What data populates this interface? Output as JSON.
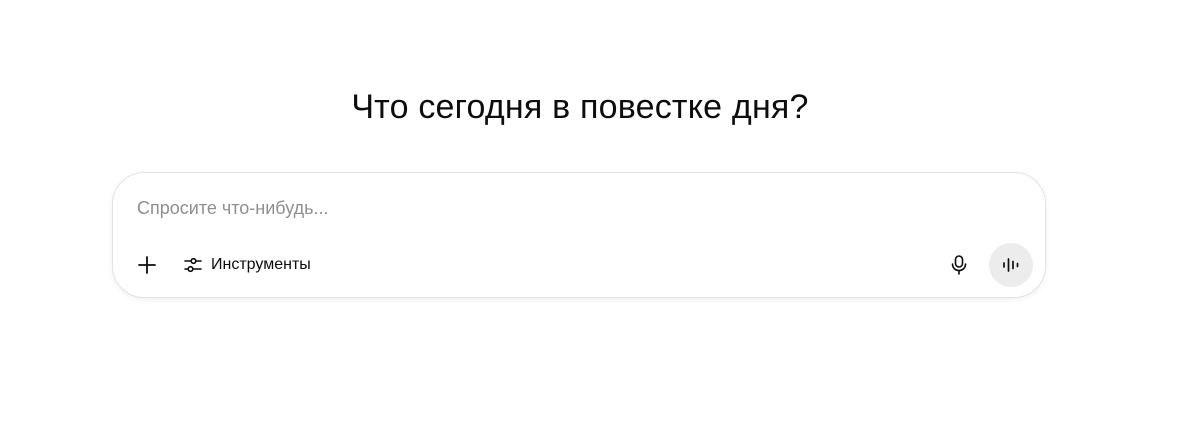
{
  "heading": "Что сегодня в повестке дня?",
  "composer": {
    "placeholder": "Спросите что-нибудь...",
    "value": "",
    "tools_label": "Инструменты"
  },
  "icons": {
    "add": "plus-icon",
    "tools": "sliders-icon",
    "mic": "microphone-icon",
    "voice": "voice-waveform-icon"
  },
  "colors": {
    "background": "#ffffff",
    "text": "#0d0d0d",
    "placeholder": "#8f8f8f",
    "composer_border": "#e3e3e3",
    "voice_button_bg": "#ececec"
  }
}
